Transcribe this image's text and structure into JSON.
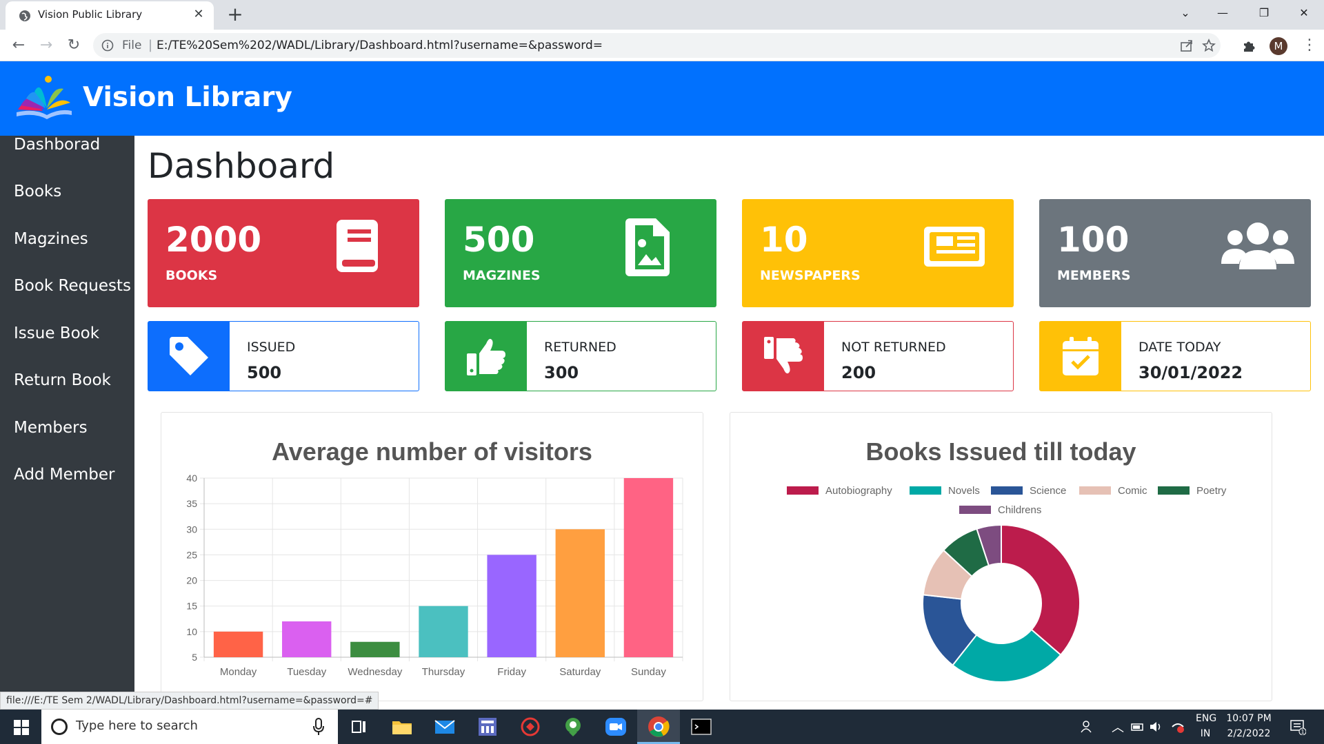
{
  "browser": {
    "tab_title": "Vision Public Library",
    "file_label": "File",
    "url": "E:/TE%20Sem%202/WADL/Library/Dashboard.html?username=&password=",
    "profile_initial": "M",
    "status_url": "file:///E:/TE Sem 2/WADL/Library/Dashboard.html?username=&password=#"
  },
  "app": {
    "brand": "Vision Library",
    "sidebar": [
      {
        "label": "Dashborad"
      },
      {
        "label": "Books"
      },
      {
        "label": "Magzines"
      },
      {
        "label": "Book Requests"
      },
      {
        "label": "Issue Book"
      },
      {
        "label": "Return Book"
      },
      {
        "label": "Members"
      },
      {
        "label": "Add Member"
      }
    ],
    "page_title": "Dashboard",
    "stats": [
      {
        "value": "2000",
        "label": "BOOKS",
        "color": "#dc3545",
        "icon": "book-icon"
      },
      {
        "value": "500",
        "label": "MAGZINES",
        "color": "#28a745",
        "icon": "image-file-icon"
      },
      {
        "value": "10",
        "label": "NEWSPAPERS",
        "color": "#ffc107",
        "icon": "newspaper-icon"
      },
      {
        "value": "100",
        "label": "MEMBERS",
        "color": "#6c757d",
        "icon": "users-icon"
      }
    ],
    "info": [
      {
        "label": "ISSUED",
        "value": "500",
        "color": "#0d6efd",
        "icon": "tag-icon"
      },
      {
        "label": "RETURNED",
        "value": "300",
        "color": "#28a745",
        "icon": "thumbs-up-icon"
      },
      {
        "label": "NOT RETURNED",
        "value": "200",
        "color": "#dc3545",
        "icon": "thumbs-down-icon"
      },
      {
        "label": "DATE TODAY",
        "value": "30/01/2022",
        "color": "#ffc107",
        "icon": "calendar-check-icon"
      }
    ]
  },
  "chart_data": [
    {
      "type": "bar",
      "title": "Average number of visitors",
      "categories": [
        "Monday",
        "Tuesday",
        "Wednesday",
        "Thursday",
        "Friday",
        "Saturday",
        "Sunday"
      ],
      "values": [
        10,
        12,
        8,
        15,
        25,
        30,
        40
      ],
      "colors": [
        "#ff6347",
        "#da60f0",
        "#3c8d40",
        "#4bc0c0",
        "#9966ff",
        "#ff9f40",
        "#ff6384"
      ],
      "ylim": [
        5,
        40
      ],
      "yticks": [
        5,
        10,
        15,
        20,
        25,
        30,
        35,
        40
      ],
      "grid": true
    },
    {
      "type": "pie",
      "title": "Books Issued till today",
      "labels": [
        "Autobiography",
        "Novels",
        "Science",
        "Comic",
        "Poetry",
        "Childrens"
      ],
      "values": [
        36,
        24,
        16,
        10,
        8,
        5
      ],
      "colors": [
        "#bc1c4c",
        "#00a9a6",
        "#2a5597",
        "#e6c1b5",
        "#1f6b45",
        "#7d4c80"
      ],
      "legend": "top"
    }
  ],
  "taskbar": {
    "search_placeholder": "Type here to search",
    "lang": "ENG",
    "region": "IN",
    "time": "10:07 PM",
    "date": "2/2/2022",
    "notification_count": "1"
  }
}
